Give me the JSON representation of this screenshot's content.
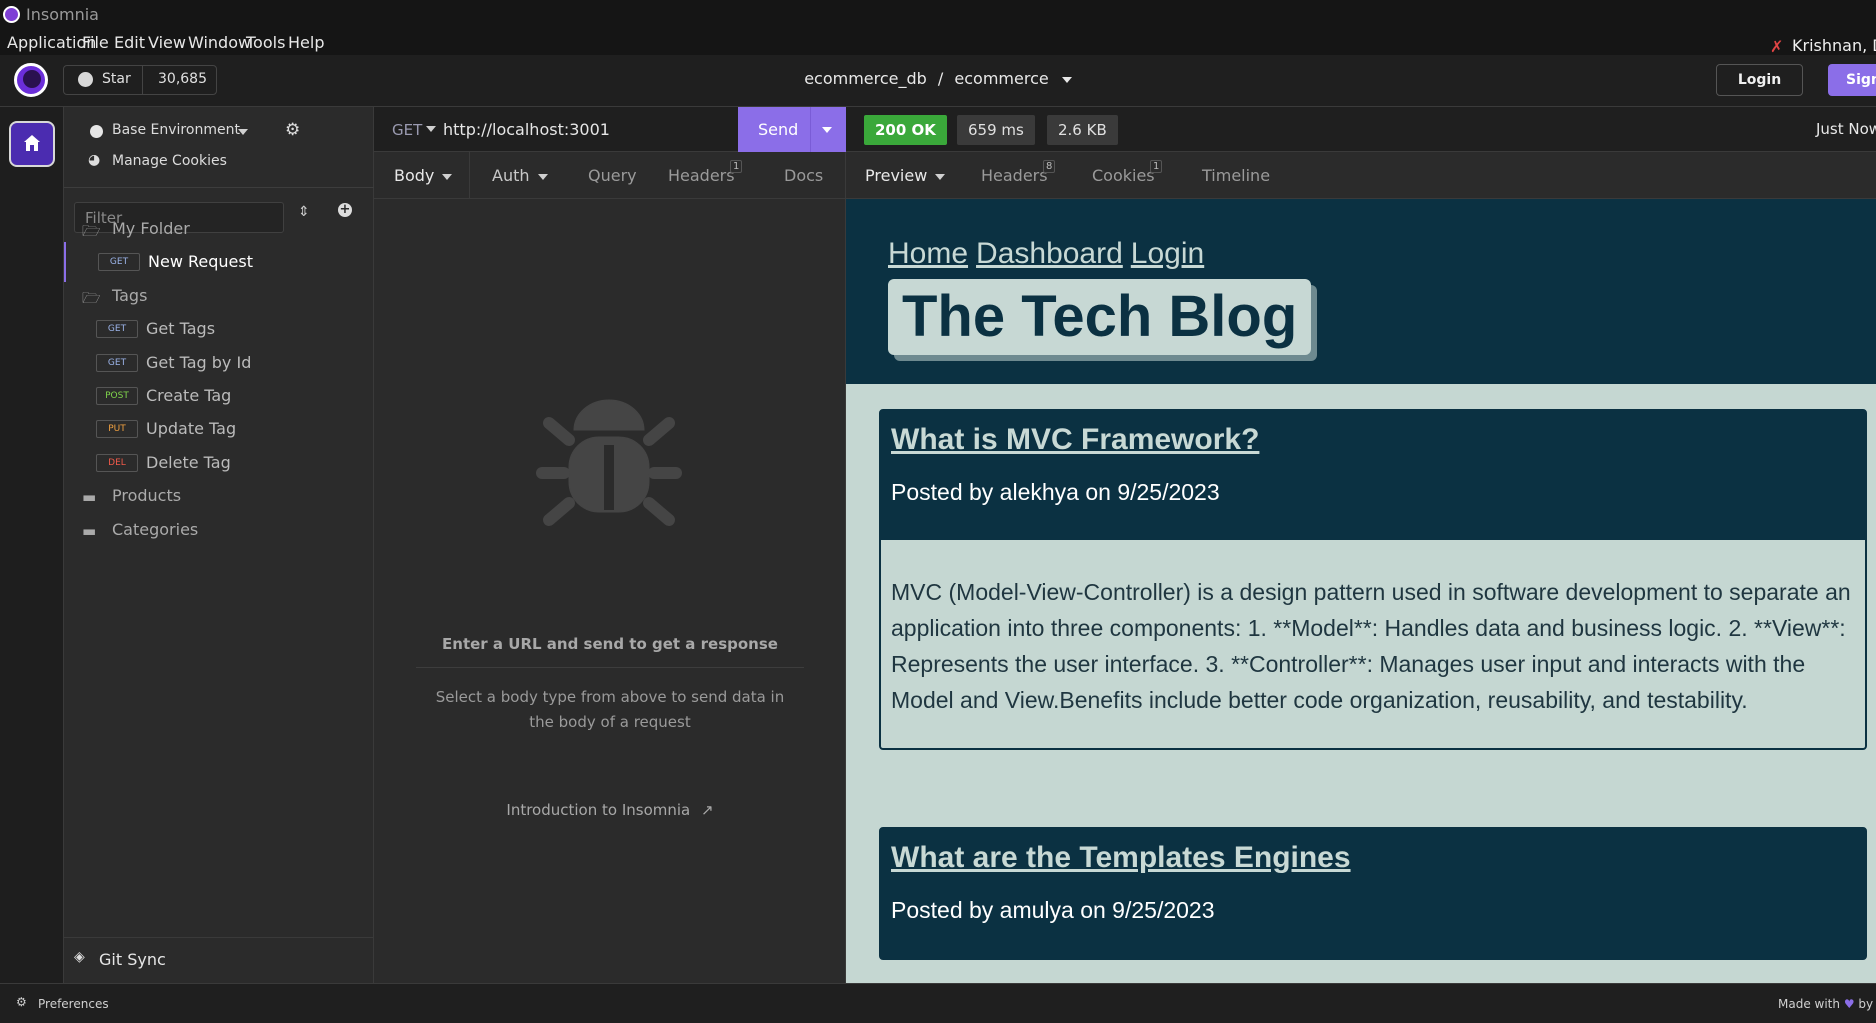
{
  "window": {
    "title": "Insomnia"
  },
  "menubar": {
    "items": [
      "Application",
      "File",
      "Edit",
      "View",
      "Window",
      "Tools",
      "Help"
    ],
    "user": "Krishnan, Di"
  },
  "topbar": {
    "star_label": "Star",
    "star_count": "30,685",
    "breadcrumb_project": "ecommerce_db",
    "breadcrumb_sep": "/",
    "breadcrumb_collection": "ecommerce",
    "login_label": "Login",
    "signup_label": "Sign"
  },
  "sidebar": {
    "environment": "Base Environment",
    "manage_cookies": "Manage Cookies",
    "filter_placeholder": "Filter",
    "tree": [
      {
        "type": "folder-open",
        "label": "My Folder"
      },
      {
        "type": "request",
        "method": "GET",
        "label": "New Request"
      },
      {
        "type": "folder-open",
        "label": "Tags"
      },
      {
        "type": "request",
        "method": "GET",
        "label": "Get Tags"
      },
      {
        "type": "request",
        "method": "GET",
        "label": "Get Tag by Id"
      },
      {
        "type": "request",
        "method": "POST",
        "label": "Create Tag"
      },
      {
        "type": "request",
        "method": "PUT",
        "label": "Update Tag"
      },
      {
        "type": "request",
        "method": "DEL",
        "label": "Delete Tag"
      },
      {
        "type": "folder",
        "label": "Products"
      },
      {
        "type": "folder",
        "label": "Categories"
      }
    ],
    "git_sync": "Git Sync"
  },
  "request": {
    "method": "GET",
    "url": "http://localhost:3001",
    "send_label": "Send",
    "tabs": {
      "body": "Body",
      "auth": "Auth",
      "query": "Query",
      "headers": "Headers",
      "headers_count": "1",
      "docs": "Docs"
    },
    "empty_title": "Enter a URL and send to get a response",
    "empty_subtitle": "Select a body type from above to send data in the body of a request",
    "intro_link": "Introduction to Insomnia"
  },
  "response": {
    "status": "200 OK",
    "time": "659 ms",
    "size": "2.6 KB",
    "timestamp": "Just Now",
    "tabs": {
      "preview": "Preview",
      "headers": "Headers",
      "headers_count": "8",
      "cookies": "Cookies",
      "cookies_count": "1",
      "timeline": "Timeline"
    }
  },
  "preview": {
    "nav": [
      "Home",
      "Dashboard",
      "Login"
    ],
    "site_title": "The Tech Blog",
    "posts": [
      {
        "title": "What is MVC Framework?",
        "byline": "Posted by alekhya on 9/25/2023",
        "body": "MVC (Model-View-Controller) is a design pattern used in software development to separate an application into three components: 1. **Model**: Handles data and business logic. 2. **View**: Represents the user interface. 3. **Controller**: Manages user input and interacts with the Model and View.Benefits include better code organization, reusability, and testability."
      },
      {
        "title": "What are the Templates Engines",
        "byline": "Posted by amulya on 9/25/2023"
      }
    ]
  },
  "footer": {
    "preferences": "Preferences",
    "made_with": "Made with",
    "by": "by I"
  }
}
